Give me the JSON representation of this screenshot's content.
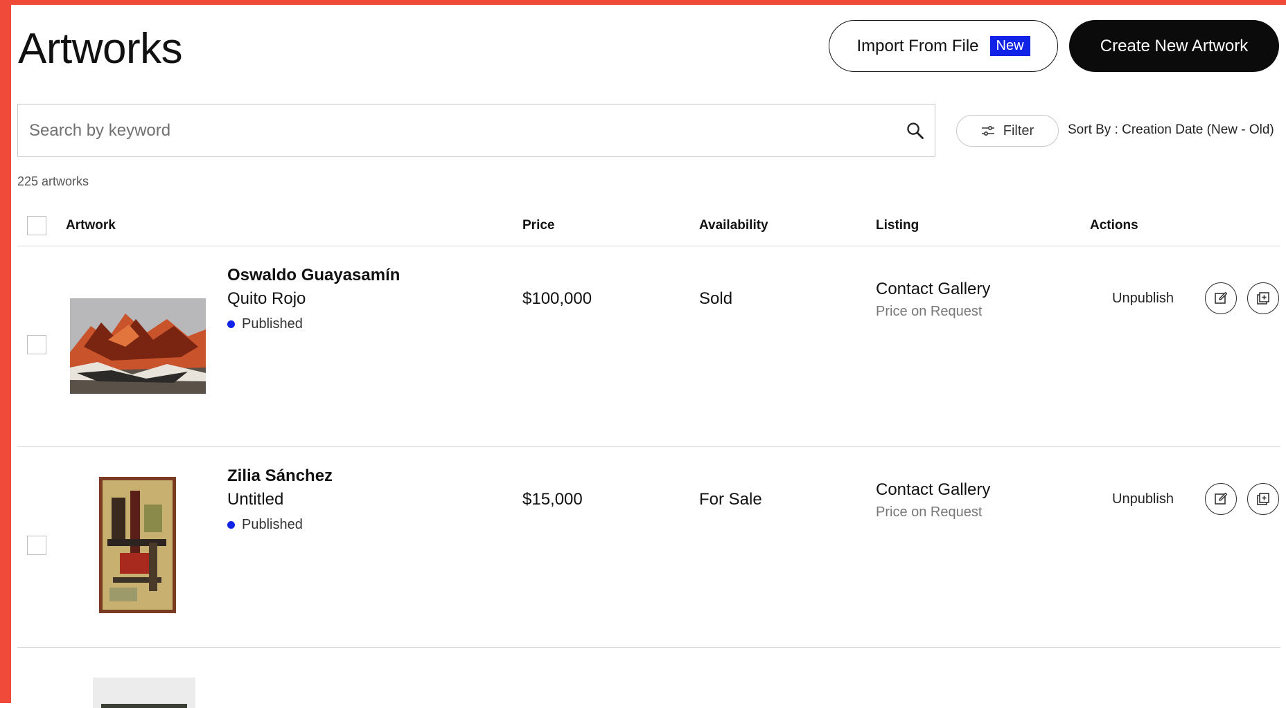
{
  "header": {
    "title": "Artworks",
    "import_label": "Import From File",
    "import_badge": "New",
    "create_label": "Create New Artwork"
  },
  "search": {
    "placeholder": "Search by keyword",
    "value": ""
  },
  "filter": {
    "label": "Filter"
  },
  "sort": {
    "label": "Sort By : Creation Date (New - Old)"
  },
  "result_count": "225 artworks",
  "table": {
    "columns": [
      "Artwork",
      "Price",
      "Availability",
      "Listing",
      "Actions"
    ],
    "rows": [
      {
        "artist": "Oswaldo Guayasamín",
        "title": "Quito Rojo",
        "status": "Published",
        "price": "$100,000",
        "availability": "Sold",
        "listing": "Contact Gallery",
        "listing_detail": "Price on Request",
        "action": "Unpublish"
      },
      {
        "artist": "Zilia Sánchez",
        "title": "Untitled",
        "status": "Published",
        "price": "$15,000",
        "availability": "For Sale",
        "listing": "Contact Gallery",
        "listing_detail": "Price on Request",
        "action": "Unpublish"
      }
    ]
  },
  "colors": {
    "frame": "#f04b3a",
    "accent_blue": "#1023e6",
    "primary_button": "#0b0b0b"
  },
  "icons": [
    "search-icon",
    "filter-icon",
    "edit-icon",
    "duplicate-icon"
  ]
}
